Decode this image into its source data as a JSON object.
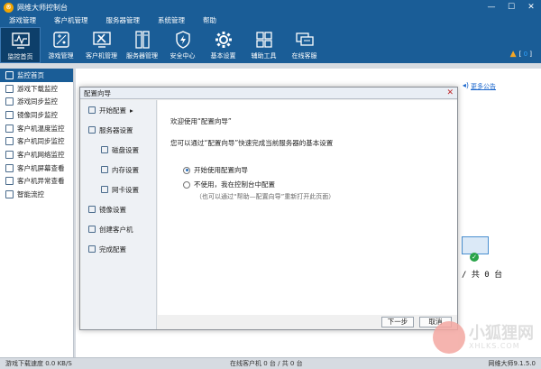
{
  "titlebar": {
    "title": "网维大师控制台",
    "logo": "®"
  },
  "menubar": [
    "游戏管理",
    "客户机管理",
    "服务器管理",
    "系统管理",
    "帮助"
  ],
  "toolbar": [
    {
      "label": "监控首页",
      "icon": "monitor-icon",
      "active": true
    },
    {
      "label": "游戏管理",
      "icon": "gamepad-icon"
    },
    {
      "label": "客户机管理",
      "icon": "tools-icon"
    },
    {
      "label": "服务器管理",
      "icon": "server-icon"
    },
    {
      "label": "安全中心",
      "icon": "shield-bolt-icon"
    },
    {
      "label": "基本设置",
      "icon": "gear-icon"
    },
    {
      "label": "辅助工具",
      "icon": "grid-icon"
    },
    {
      "label": "在线客服",
      "icon": "chat-icon"
    }
  ],
  "topright": {
    "left_bracket": "[",
    "count": "0",
    "right_bracket": "]"
  },
  "sidebar": [
    {
      "label": "监控首页",
      "active": true
    },
    {
      "label": "游戏下载监控"
    },
    {
      "label": "游戏同步监控"
    },
    {
      "label": "镜像同步监控"
    },
    {
      "label": "客户机温度监控"
    },
    {
      "label": "客户机同步监控"
    },
    {
      "label": "客户机网络监控"
    },
    {
      "label": "客户机屏幕查看"
    },
    {
      "label": "客户机异常查看"
    },
    {
      "label": "智能流控"
    }
  ],
  "main": {
    "notice_link": "更多公告",
    "count_text": "/ 共 0 台"
  },
  "dialog": {
    "title": "配置向导",
    "steps": [
      {
        "label": "开始配置",
        "arrow": "▸"
      },
      {
        "label": "服务器设置"
      },
      {
        "label": "磁盘设置",
        "sub": true
      },
      {
        "label": "内存设置",
        "sub": true
      },
      {
        "label": "网卡设置",
        "sub": true
      },
      {
        "label": "镜像设置"
      },
      {
        "label": "创建客户机"
      },
      {
        "label": "完成配置"
      }
    ],
    "welcome": "欢迎使用“配置向导”",
    "desc": "您可以通过“配置向导”快速完成当前服务器的基本设置",
    "option1": "开始使用配置向导",
    "option2": "不使用，我在控制台中配置",
    "hint": "（也可以通过“帮助—配置向导”重新打开此页面）",
    "next_button": "下一步",
    "cancel_button": "取消"
  },
  "statusbar": {
    "download_speed": "游戏下载速度 0.0 KB/S",
    "online": "在线客户机 0 台 / 共 0 台",
    "version": "网维大师9.1.5.0"
  },
  "watermark": {
    "text": "小狐狸网",
    "sub": "XHLKS.COM"
  }
}
